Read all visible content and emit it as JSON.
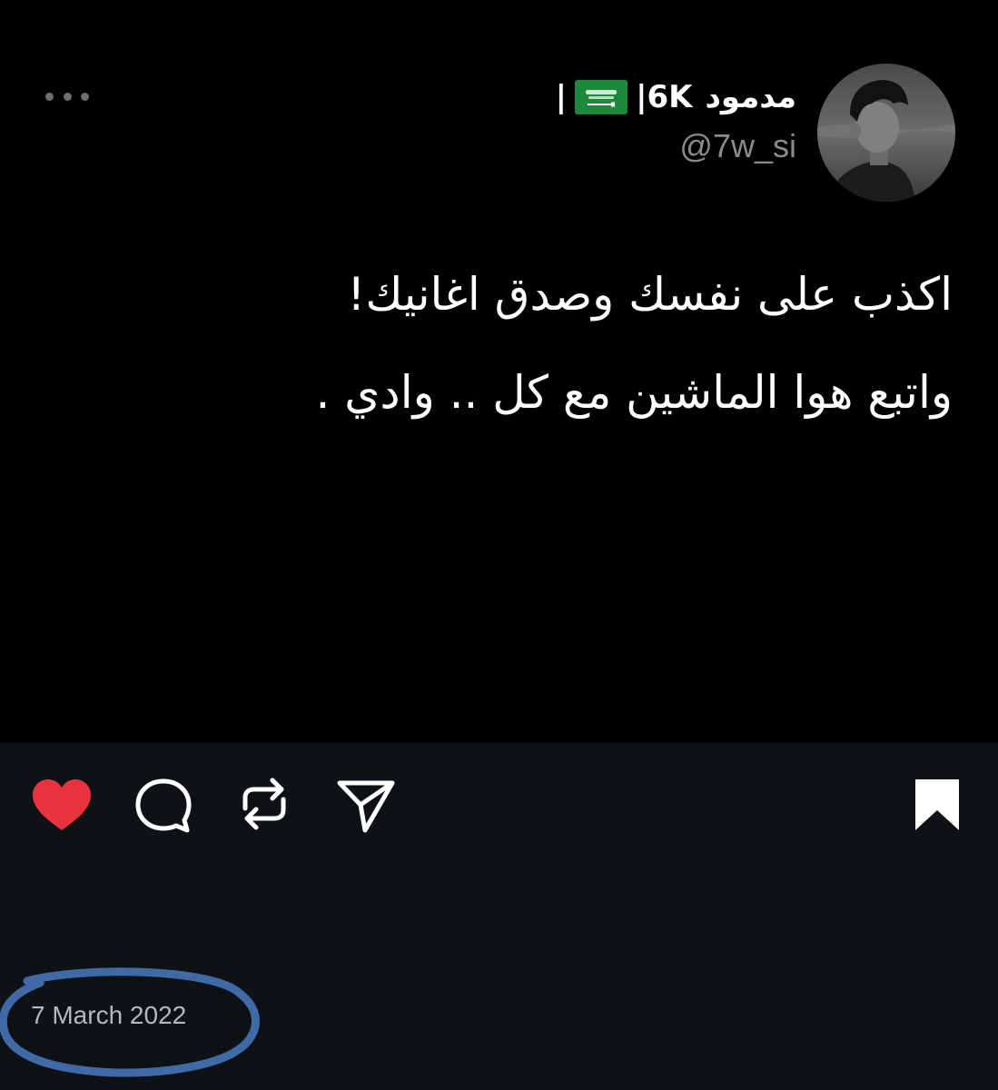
{
  "post": {
    "author": {
      "display_name_arabic": "مدمود",
      "display_name_count": "|6K",
      "flag_icon": "saudi-flag-icon",
      "display_name_suffix": "|",
      "handle": "@7w_si"
    },
    "text_lines": [
      "اكذب على نفسك وصدق اغانيك!",
      "واتبع هوا الماشين مع كل .. وادي ."
    ]
  },
  "actions": {
    "like_icon": "heart-icon",
    "comment_icon": "comment-icon",
    "repost_icon": "repost-icon",
    "share_icon": "send-icon",
    "save_icon": "bookmark-icon"
  },
  "date": "7 March 2022",
  "colors": {
    "like": "#e8323c",
    "footer_background": "#0e1217",
    "annotation_circle": "#3f6aa5"
  }
}
